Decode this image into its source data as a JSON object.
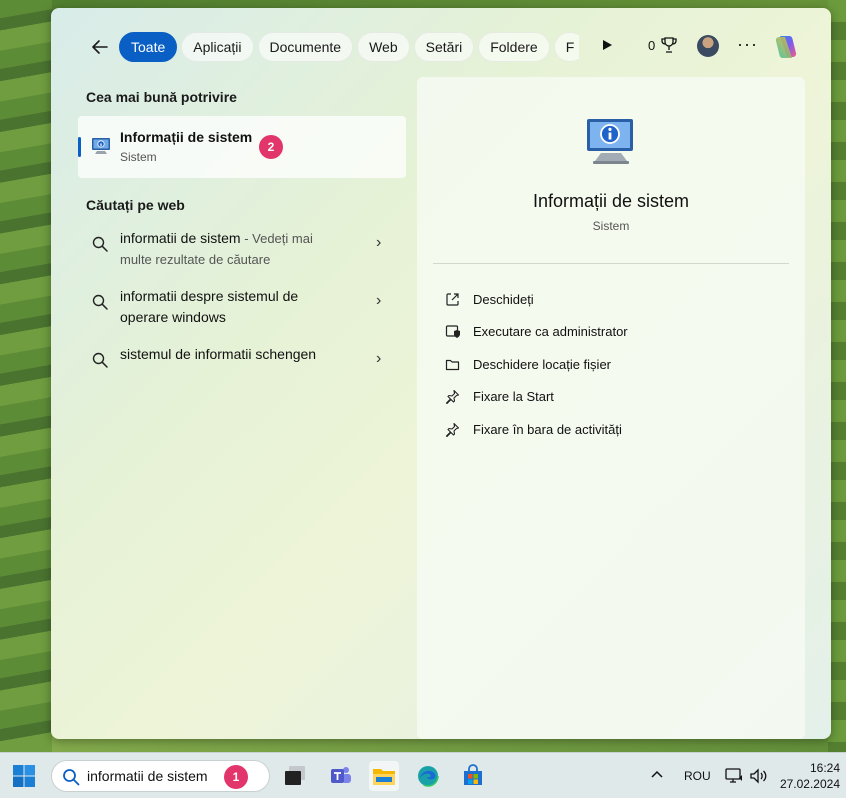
{
  "topbar": {
    "filters": [
      "Toate",
      "Aplicații",
      "Documente",
      "Web",
      "Setări",
      "Foldere",
      "F"
    ],
    "active_filter_index": 0,
    "points": "0"
  },
  "best_match": {
    "heading": "Cea mai bună potrivire",
    "title": "Informații de sistem",
    "subtitle": "Sistem",
    "badge": "2"
  },
  "web": {
    "heading": "Căutați pe web",
    "results": [
      {
        "line1": "informatii de sistem",
        "suffix": " - Vedeți mai",
        "line2": "multe rezultate de căutare"
      },
      {
        "line1": "informatii despre sistemul de",
        "line2": "operare windows"
      },
      {
        "line1": "sistemul de informatii schengen"
      }
    ]
  },
  "detail": {
    "title": "Informații de sistem",
    "subtitle": "Sistem",
    "actions": [
      {
        "label": "Deschideți",
        "icon": "open-external-icon"
      },
      {
        "label": "Executare ca administrator",
        "icon": "shield-admin-icon"
      },
      {
        "label": "Deschidere locație fișier",
        "icon": "folder-icon"
      },
      {
        "label": "Fixare la Start",
        "icon": "pin-icon"
      },
      {
        "label": "Fixare în bara de activități",
        "icon": "pin-icon"
      }
    ]
  },
  "taskbar": {
    "search_value": "informatii de sistem",
    "search_badge": "1",
    "language": "ROU",
    "time": "16:24",
    "date": "27.02.2024"
  },
  "colors": {
    "accent": "#0a5fc4",
    "badge": "#e2356b"
  }
}
